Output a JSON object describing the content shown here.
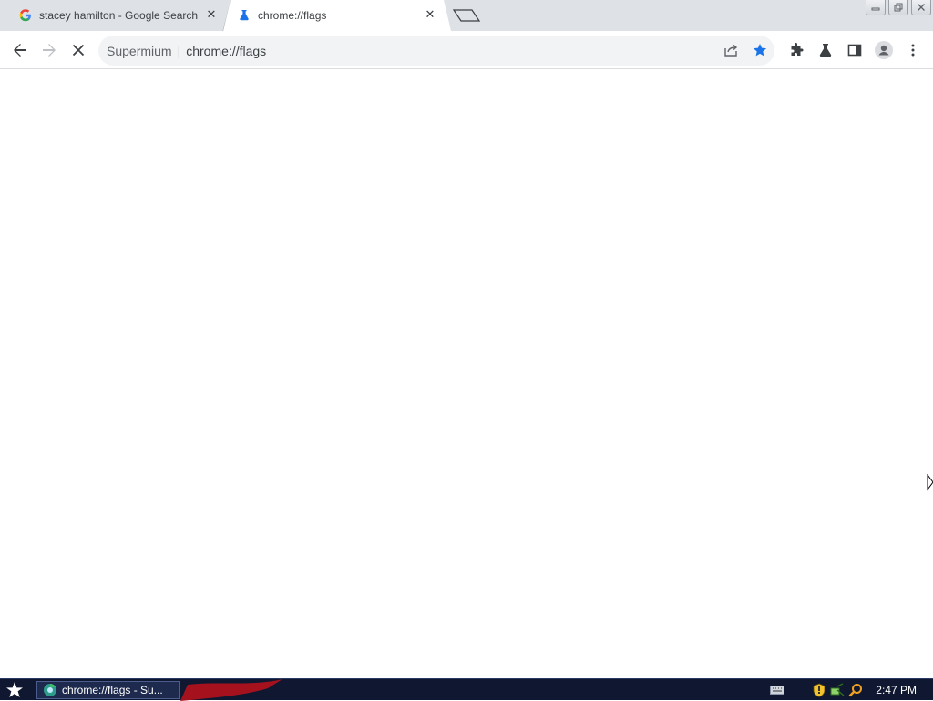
{
  "tabs": [
    {
      "title": "stacey hamilton - Google Search",
      "favicon": "google-icon",
      "active": false
    },
    {
      "title": "chrome://flags",
      "favicon": "flask-pin-icon",
      "active": true
    }
  ],
  "toolbar": {
    "omnibox_label": "Supermium",
    "url": "chrome://flags",
    "icons": [
      "back-icon",
      "forward-icon",
      "stop-icon",
      "share-icon",
      "bookmark-star-icon",
      "extensions-icon",
      "labs-icon",
      "side-panel-icon",
      "profile-icon",
      "menu-icon"
    ],
    "bookmark_color": "#1a73e8"
  },
  "taskbar": {
    "task_label": "chrome://flags - Su...",
    "clock": "2:47 PM",
    "tray_icons": [
      "keyboard-icon",
      "shield-icon",
      "network-icon",
      "search-icon"
    ]
  },
  "colors": {
    "tabstrip": "#dee1e6",
    "taskbar": "#0f1830",
    "accent": "#1a73e8"
  }
}
